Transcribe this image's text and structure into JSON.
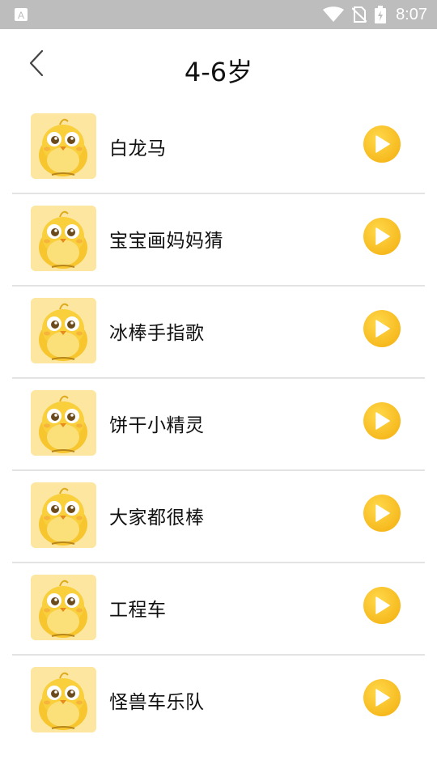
{
  "status_bar": {
    "time": "8:07",
    "icons": [
      "a-notification-icon",
      "wifi-icon",
      "no-sim-icon",
      "battery-charging-icon"
    ]
  },
  "header": {
    "title": "4-6岁",
    "back_icon": "chevron-left-icon"
  },
  "songs": [
    {
      "name": "白龙马"
    },
    {
      "name": "宝宝画妈妈猜"
    },
    {
      "name": "冰棒手指歌"
    },
    {
      "name": "饼干小精灵"
    },
    {
      "name": "大家都很棒"
    },
    {
      "name": "工程车"
    },
    {
      "name": "怪兽车乐队"
    }
  ],
  "colors": {
    "play_button": "#f6b81c",
    "thumbnail_bg": "#fde7a0",
    "divider": "#e3e3e3",
    "status_bar": "#bdbdbd"
  }
}
